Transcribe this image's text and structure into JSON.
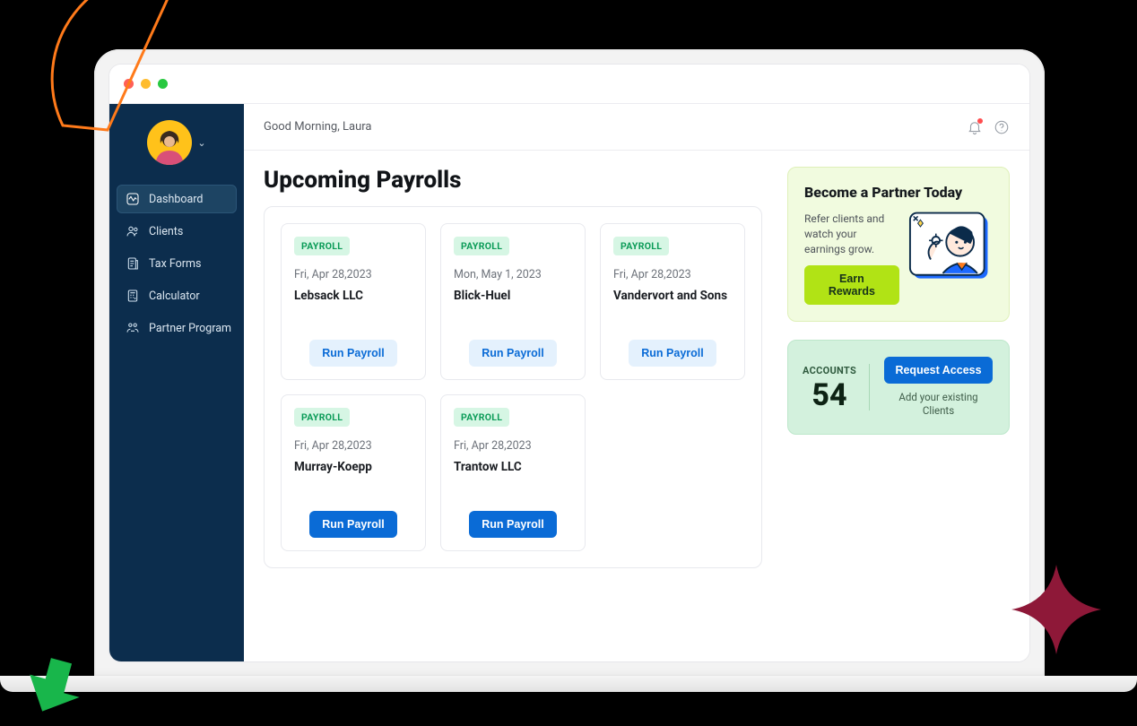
{
  "greeting": "Good Morning, Laura",
  "page_title": "Upcoming Payrolls",
  "sidebar": {
    "items": [
      {
        "label": "Dashboard"
      },
      {
        "label": "Clients"
      },
      {
        "label": "Tax Forms"
      },
      {
        "label": "Calculator"
      },
      {
        "label": "Partner Program"
      }
    ]
  },
  "badge_label": "PAYROLL",
  "run_label": "Run Payroll",
  "payrolls": [
    {
      "date": "Fri, Apr 28,2023",
      "name": "Lebsack LLC",
      "btn": "light"
    },
    {
      "date": "Mon, May 1, 2023",
      "name": "Blick-Huel",
      "btn": "light"
    },
    {
      "date": "Fri, Apr 28,2023",
      "name": "Vandervort and Sons",
      "btn": "light"
    },
    {
      "date": "Fri, Apr 28,2023",
      "name": "Murray-Koepp",
      "btn": "solid"
    },
    {
      "date": "Fri, Apr 28,2023",
      "name": "Trantow LLC",
      "btn": "solid"
    }
  ],
  "promo": {
    "title": "Become a Partner Today",
    "text": "Refer clients and watch your earnings grow.",
    "cta": "Earn Rewards"
  },
  "accounts": {
    "label": "ACCOUNTS",
    "count": "54",
    "request_label": "Request Access",
    "subtext": "Add your existing Clients"
  }
}
